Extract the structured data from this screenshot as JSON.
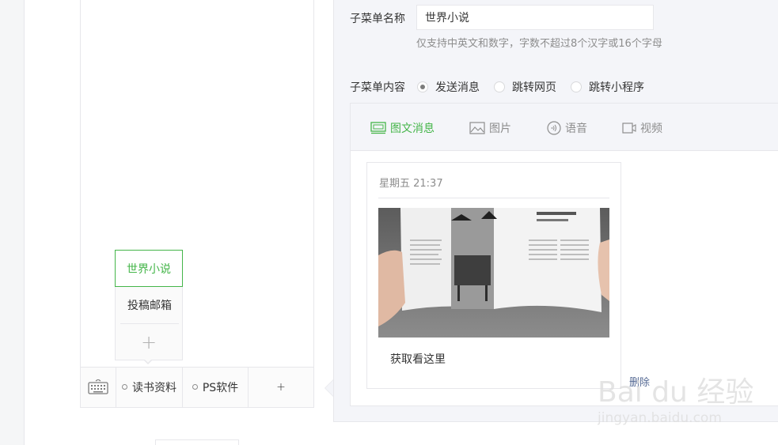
{
  "form": {
    "name_label": "子菜单名称",
    "name_value": "世界小说",
    "name_tip": "仅支持中英文和数字，字数不超过8个汉字或16个字母",
    "content_label": "子菜单内容",
    "options": [
      {
        "label": "发送消息",
        "checked": true
      },
      {
        "label": "跳转网页",
        "checked": false
      },
      {
        "label": "跳转小程序",
        "checked": false
      }
    ]
  },
  "tabs": [
    {
      "label": "图文消息",
      "icon": "news-icon",
      "active": true
    },
    {
      "label": "图片",
      "icon": "image-icon",
      "active": false
    },
    {
      "label": "语音",
      "icon": "voice-icon",
      "active": false
    },
    {
      "label": "视频",
      "icon": "video-icon",
      "active": false
    }
  ],
  "card": {
    "date": "星期五 21:37",
    "title": "获取看这里",
    "delete": "删除"
  },
  "preview": {
    "menu": [
      {
        "label": "读书资料"
      },
      {
        "label": "PS软件"
      }
    ],
    "add_symbol": "+",
    "submenu": [
      {
        "label": "世界小说",
        "active": true
      },
      {
        "label": "投稿邮箱",
        "active": false
      }
    ],
    "submenu_add": "+"
  },
  "watermark": {
    "brand": "Bai du 经验",
    "url": "jingyan.baidu.com"
  },
  "colors": {
    "accent": "#44b549",
    "link": "#576b95",
    "border": "#e7e7eb",
    "panel_bg": "#f4f5f9",
    "muted": "#8d8d8d"
  }
}
